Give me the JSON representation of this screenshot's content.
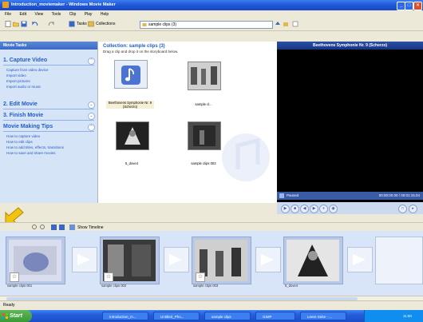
{
  "window": {
    "title": "Introduction_moviemaker - Windows Movie Maker"
  },
  "menu": [
    "File",
    "Edit",
    "View",
    "Tools",
    "Clip",
    "Play",
    "Help"
  ],
  "toolbar": {
    "tasks_label": "Tasks",
    "collections_label": "Collections",
    "collection_value": "sample clips (3)"
  },
  "task_pane": {
    "header": "Movie Tasks",
    "sections": [
      {
        "title": "1. Capture Video",
        "links": [
          "Capture from video device",
          "Import video",
          "Import pictures",
          "Import audio or music"
        ]
      },
      {
        "title": "2. Edit Movie",
        "links": []
      },
      {
        "title": "3. Finish Movie",
        "links": []
      },
      {
        "title": "Movie Making Tips",
        "links": [
          "How to capture video",
          "How to edit clips",
          "How to add titles, effects, transitions",
          "How to save and share movies"
        ]
      }
    ]
  },
  "collection": {
    "title": "Collection: sample clips (3)",
    "subtitle": "Drag a clip and drop it on the storyboard below.",
    "clips": [
      {
        "caption": "Beethovens Symphonie Nr. 9 (Scherzo)",
        "icon": "music-note-icon"
      },
      {
        "caption": "sample cl...",
        "icon": "video-thumbnail"
      },
      {
        "caption": "5_dove4",
        "icon": "video-thumbnail"
      },
      {
        "caption": "sample clips 003",
        "icon": "video-thumbnail"
      }
    ]
  },
  "preview": {
    "title": "Beethovens Symphonie Nr. 9 (Scherzo)",
    "status": "Paused",
    "time": "00:00:00.00 / 00:01:15.04"
  },
  "storyboard_toolbar": {
    "show_timeline": "Show Timeline"
  },
  "storyboard": {
    "clips": [
      {
        "caption": "sample clips 001"
      },
      {
        "caption": "sample clips 002"
      },
      {
        "caption": "sample clips 003"
      },
      {
        "caption": "5_dove4"
      }
    ]
  },
  "status": {
    "text": "Ready"
  },
  "taskbar": {
    "start": "Start",
    "tasks": [
      "Introduction_m...",
      "Untitled_Pho...",
      "sample clips",
      "GIMP",
      "Leere Seite - ..."
    ],
    "clock": "11:50"
  },
  "colors": {
    "accent": "#215dc6",
    "titlebar": "#1f57d6",
    "taskbar": "#245ddb"
  }
}
